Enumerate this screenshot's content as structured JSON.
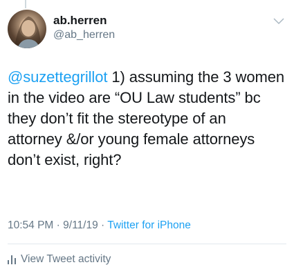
{
  "author": {
    "display_name": "ab.herren",
    "handle": "@ab_herren"
  },
  "tweet": {
    "mention": "@suzettegrillot",
    "text": " 1) assuming the 3 women in the video are “OU Law students” bc they don’t fit the stereotype of an attorney &/or young female attorneys don’t exist, right?",
    "time": "10:54 PM",
    "date": "9/11/19",
    "separator": "·",
    "source": "Twitter for iPhone"
  },
  "actions": {
    "view_activity": "View Tweet activity"
  },
  "icons": {
    "menu": "chevron-down-icon",
    "activity": "bar-chart-icon"
  },
  "colors": {
    "link": "#1da1f2",
    "secondary_text": "#657786",
    "primary_text": "#14171a",
    "divider": "#e1e8ed"
  }
}
